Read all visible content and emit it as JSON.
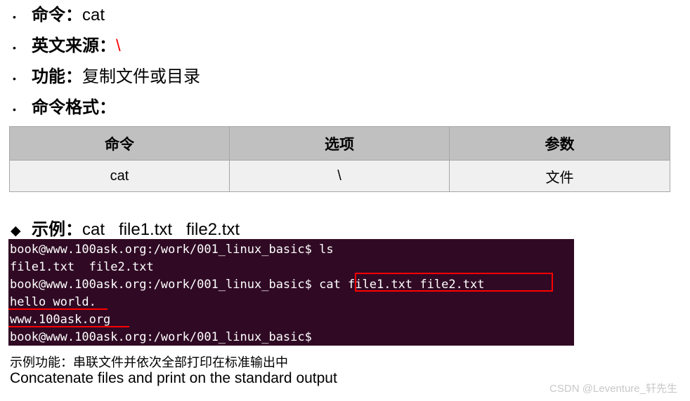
{
  "slide": {
    "bullets": [
      {
        "marker": "•",
        "marker_name": "round-bullet",
        "label": "命令：",
        "value": "cat",
        "value_color": "#000000"
      },
      {
        "marker": "•",
        "marker_name": "round-bullet",
        "label": "英文来源：",
        "value": "\\",
        "value_color": "#ff0000"
      },
      {
        "marker": "•",
        "marker_name": "round-bullet",
        "label": "功能：",
        "value": "复制文件或目录",
        "value_color": "#000000"
      },
      {
        "marker": "•",
        "marker_name": "round-bullet",
        "label": "命令格式：",
        "value": "",
        "value_color": "#000000"
      }
    ],
    "table": {
      "headers": [
        "命令",
        "选项",
        "参数"
      ],
      "rows": [
        [
          "cat",
          "\\",
          "文件"
        ]
      ],
      "header_bg": "#c0c0c0",
      "row_bg": "#f0f0f0",
      "border_color": "#a6a6a6"
    },
    "example": {
      "marker": "◆",
      "marker_name": "diamond-bullet",
      "label": "示例：",
      "value": "cat   file1.txt   file2.txt"
    },
    "terminal": {
      "background": "#300a24",
      "text_color": "#ffffff",
      "lines": [
        "book@www.100ask.org:/work/001_linux_basic$ ls",
        "file1.txt  file2.txt",
        "book@www.100ask.org:/work/001_linux_basic$ cat file1.txt file2.txt",
        "hello world.",
        "www.100ask.org",
        "book@www.100ask.org:/work/001_linux_basic$"
      ],
      "annotations": {
        "highlight_color": "#ff0000",
        "box_text": "cat file1.txt file2.txt",
        "underline_1_text": "hello world.",
        "underline_2_text": "www.100ask.org"
      }
    },
    "notes": {
      "cn": "示例功能：串联文件并依次全部打印在标准输出中",
      "en": "Concatenate files and print on the standard output"
    },
    "watermark": "CSDN @Leventure_轩先生"
  }
}
